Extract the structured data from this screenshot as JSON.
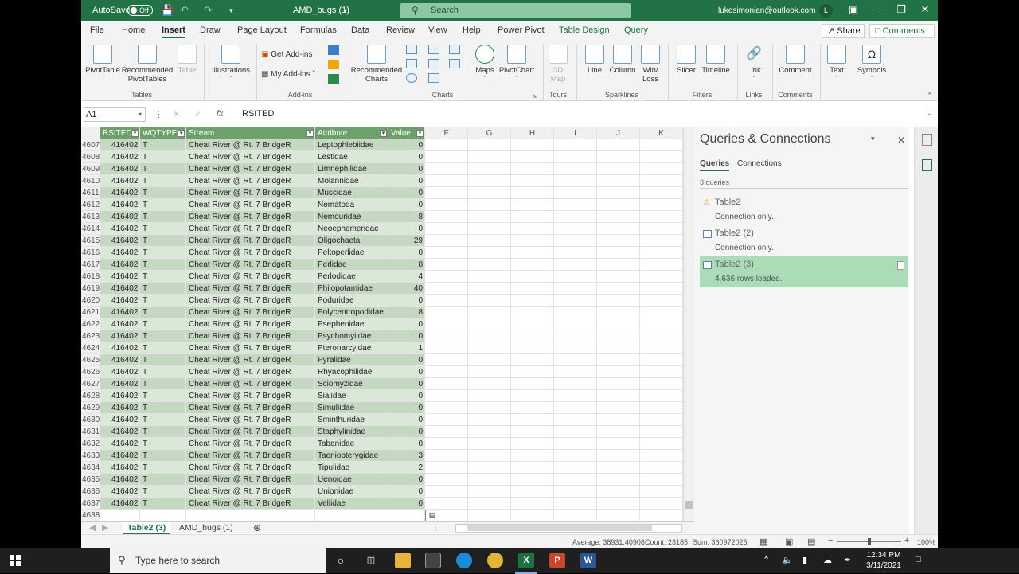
{
  "titlebar": {
    "autosave": "AutoSave",
    "autosave_state": "Off",
    "doc_title": "AMD_bugs (1)",
    "search_placeholder": "Search",
    "user": "lukesimonian@outlook.com",
    "avatar_initial": "L"
  },
  "tabs": [
    "File",
    "Home",
    "Insert",
    "Draw",
    "Page Layout",
    "Formulas",
    "Data",
    "Review",
    "View",
    "Help",
    "Power Pivot",
    "Table Design",
    "Query"
  ],
  "share_label": "Share",
  "comments_label": "Comments",
  "ribbon": {
    "pivottable": "PivotTable",
    "recommended_pivottables_1": "Recommended",
    "recommended_pivottables_2": "PivotTables",
    "table": "Table",
    "tables_group": "Tables",
    "illustrations": "Illustrations",
    "get_addins": "Get Add-ins",
    "my_addins": "My Add-ins",
    "addins_group": "Add-ins",
    "recommended_charts_1": "Recommended",
    "recommended_charts_2": "Charts",
    "maps": "Maps",
    "pivotchart": "PivotChart",
    "charts_group": "Charts",
    "map3d_1": "3D",
    "map3d_2": "Map",
    "tours_group": "Tours",
    "line": "Line",
    "column": "Column",
    "winloss_1": "Win/",
    "winloss_2": "Loss",
    "sparklines_group": "Sparklines",
    "slicer": "Slicer",
    "timeline": "Timeline",
    "filters_group": "Filters",
    "link": "Link",
    "links_group": "Links",
    "comment": "Comment",
    "comments_group": "Comments",
    "text": "Text",
    "symbols": "Symbols"
  },
  "formula_bar": {
    "name_box": "A1",
    "formula": "RSITED"
  },
  "grid": {
    "headers": [
      "RSITED",
      "WQTYPE",
      "Stream",
      "Attribute",
      "Value"
    ],
    "extra_columns": [
      "F",
      "G",
      "H",
      "I",
      "J",
      "K"
    ],
    "rows": [
      [
        "4607",
        "416402",
        "T",
        "Cheat River @ Rt. 7 BridgeR",
        "Leptophlebiidae",
        "0"
      ],
      [
        "4608",
        "416402",
        "T",
        "Cheat River @ Rt. 7 BridgeR",
        "Lestidae",
        "0"
      ],
      [
        "4609",
        "416402",
        "T",
        "Cheat River @ Rt. 7 BridgeR",
        "Limnephilidae",
        "0"
      ],
      [
        "4610",
        "416402",
        "T",
        "Cheat River @ Rt. 7 BridgeR",
        "Molannidae",
        "0"
      ],
      [
        "4611",
        "416402",
        "T",
        "Cheat River @ Rt. 7 BridgeR",
        "Muscidae",
        "0"
      ],
      [
        "4612",
        "416402",
        "T",
        "Cheat River @ Rt. 7 BridgeR",
        "Nematoda",
        "0"
      ],
      [
        "4613",
        "416402",
        "T",
        "Cheat River @ Rt. 7 BridgeR",
        "Nemouridae",
        "8"
      ],
      [
        "4614",
        "416402",
        "T",
        "Cheat River @ Rt. 7 BridgeR",
        "Neoephemeridae",
        "0"
      ],
      [
        "4615",
        "416402",
        "T",
        "Cheat River @ Rt. 7 BridgeR",
        "Oligochaeta",
        "29"
      ],
      [
        "4616",
        "416402",
        "T",
        "Cheat River @ Rt. 7 BridgeR",
        "Peltoperlidae",
        "0"
      ],
      [
        "4617",
        "416402",
        "T",
        "Cheat River @ Rt. 7 BridgeR",
        "Perlidae",
        "8"
      ],
      [
        "4618",
        "416402",
        "T",
        "Cheat River @ Rt. 7 BridgeR",
        "Perlodidae",
        "4"
      ],
      [
        "4619",
        "416402",
        "T",
        "Cheat River @ Rt. 7 BridgeR",
        "Philopotamidae",
        "40"
      ],
      [
        "4620",
        "416402",
        "T",
        "Cheat River @ Rt. 7 BridgeR",
        "Poduridae",
        "0"
      ],
      [
        "4621",
        "416402",
        "T",
        "Cheat River @ Rt. 7 BridgeR",
        "Polycentropodidae",
        "8"
      ],
      [
        "4622",
        "416402",
        "T",
        "Cheat River @ Rt. 7 BridgeR",
        "Psephenidae",
        "0"
      ],
      [
        "4623",
        "416402",
        "T",
        "Cheat River @ Rt. 7 BridgeR",
        "Psychomyiidae",
        "0"
      ],
      [
        "4624",
        "416402",
        "T",
        "Cheat River @ Rt. 7 BridgeR",
        "Pteronarcyidae",
        "1"
      ],
      [
        "4625",
        "416402",
        "T",
        "Cheat River @ Rt. 7 BridgeR",
        "Pyralidae",
        "0"
      ],
      [
        "4626",
        "416402",
        "T",
        "Cheat River @ Rt. 7 BridgeR",
        "Rhyacophilidae",
        "0"
      ],
      [
        "4627",
        "416402",
        "T",
        "Cheat River @ Rt. 7 BridgeR",
        "Sciomyzidae",
        "0"
      ],
      [
        "4628",
        "416402",
        "T",
        "Cheat River @ Rt. 7 BridgeR",
        "Sialidae",
        "0"
      ],
      [
        "4629",
        "416402",
        "T",
        "Cheat River @ Rt. 7 BridgeR",
        "Simuliidae",
        "0"
      ],
      [
        "4630",
        "416402",
        "T",
        "Cheat River @ Rt. 7 BridgeR",
        "Sminthuridae",
        "0"
      ],
      [
        "4631",
        "416402",
        "T",
        "Cheat River @ Rt. 7 BridgeR",
        "Staphylinidae",
        "0"
      ],
      [
        "4632",
        "416402",
        "T",
        "Cheat River @ Rt. 7 BridgeR",
        "Tabanidae",
        "0"
      ],
      [
        "4633",
        "416402",
        "T",
        "Cheat River @ Rt. 7 BridgeR",
        "Taeniopterygidae",
        "3"
      ],
      [
        "4634",
        "416402",
        "T",
        "Cheat River @ Rt. 7 BridgeR",
        "Tipulidae",
        "2"
      ],
      [
        "4635",
        "416402",
        "T",
        "Cheat River @ Rt. 7 BridgeR",
        "Uenoidae",
        "0"
      ],
      [
        "4636",
        "416402",
        "T",
        "Cheat River @ Rt. 7 BridgeR",
        "Unionidae",
        "0"
      ],
      [
        "4637",
        "416402",
        "T",
        "Cheat River @ Rt. 7 BridgeR",
        "Veliidae",
        "0"
      ]
    ],
    "last_row_number": "4638"
  },
  "sheets": {
    "active": "Table2 (3)",
    "other": "AMD_bugs (1)"
  },
  "status": {
    "average": "Average: 38931.40908",
    "count": "Count: 23185",
    "sum": "Sum: 360972025",
    "zoom": "100%"
  },
  "queries": {
    "title": "Queries & Connections",
    "tab_queries": "Queries",
    "tab_connections": "Connections",
    "count": "3 queries",
    "items": [
      {
        "name": "Table2",
        "status": "Connection only."
      },
      {
        "name": "Table2 (2)",
        "status": "Connection only."
      },
      {
        "name": "Table2 (3)",
        "status": "4,636 rows loaded."
      }
    ]
  },
  "taskbar": {
    "search_placeholder": "Type here to search",
    "time": "12:34 PM",
    "date": "3/11/2021"
  },
  "colors": {
    "excel_green": "#217346",
    "table_header": "#6da06b",
    "band_dark": "#c5d8c1",
    "band_light": "#dbe7d8",
    "selected_query": "#a9dcb7"
  }
}
